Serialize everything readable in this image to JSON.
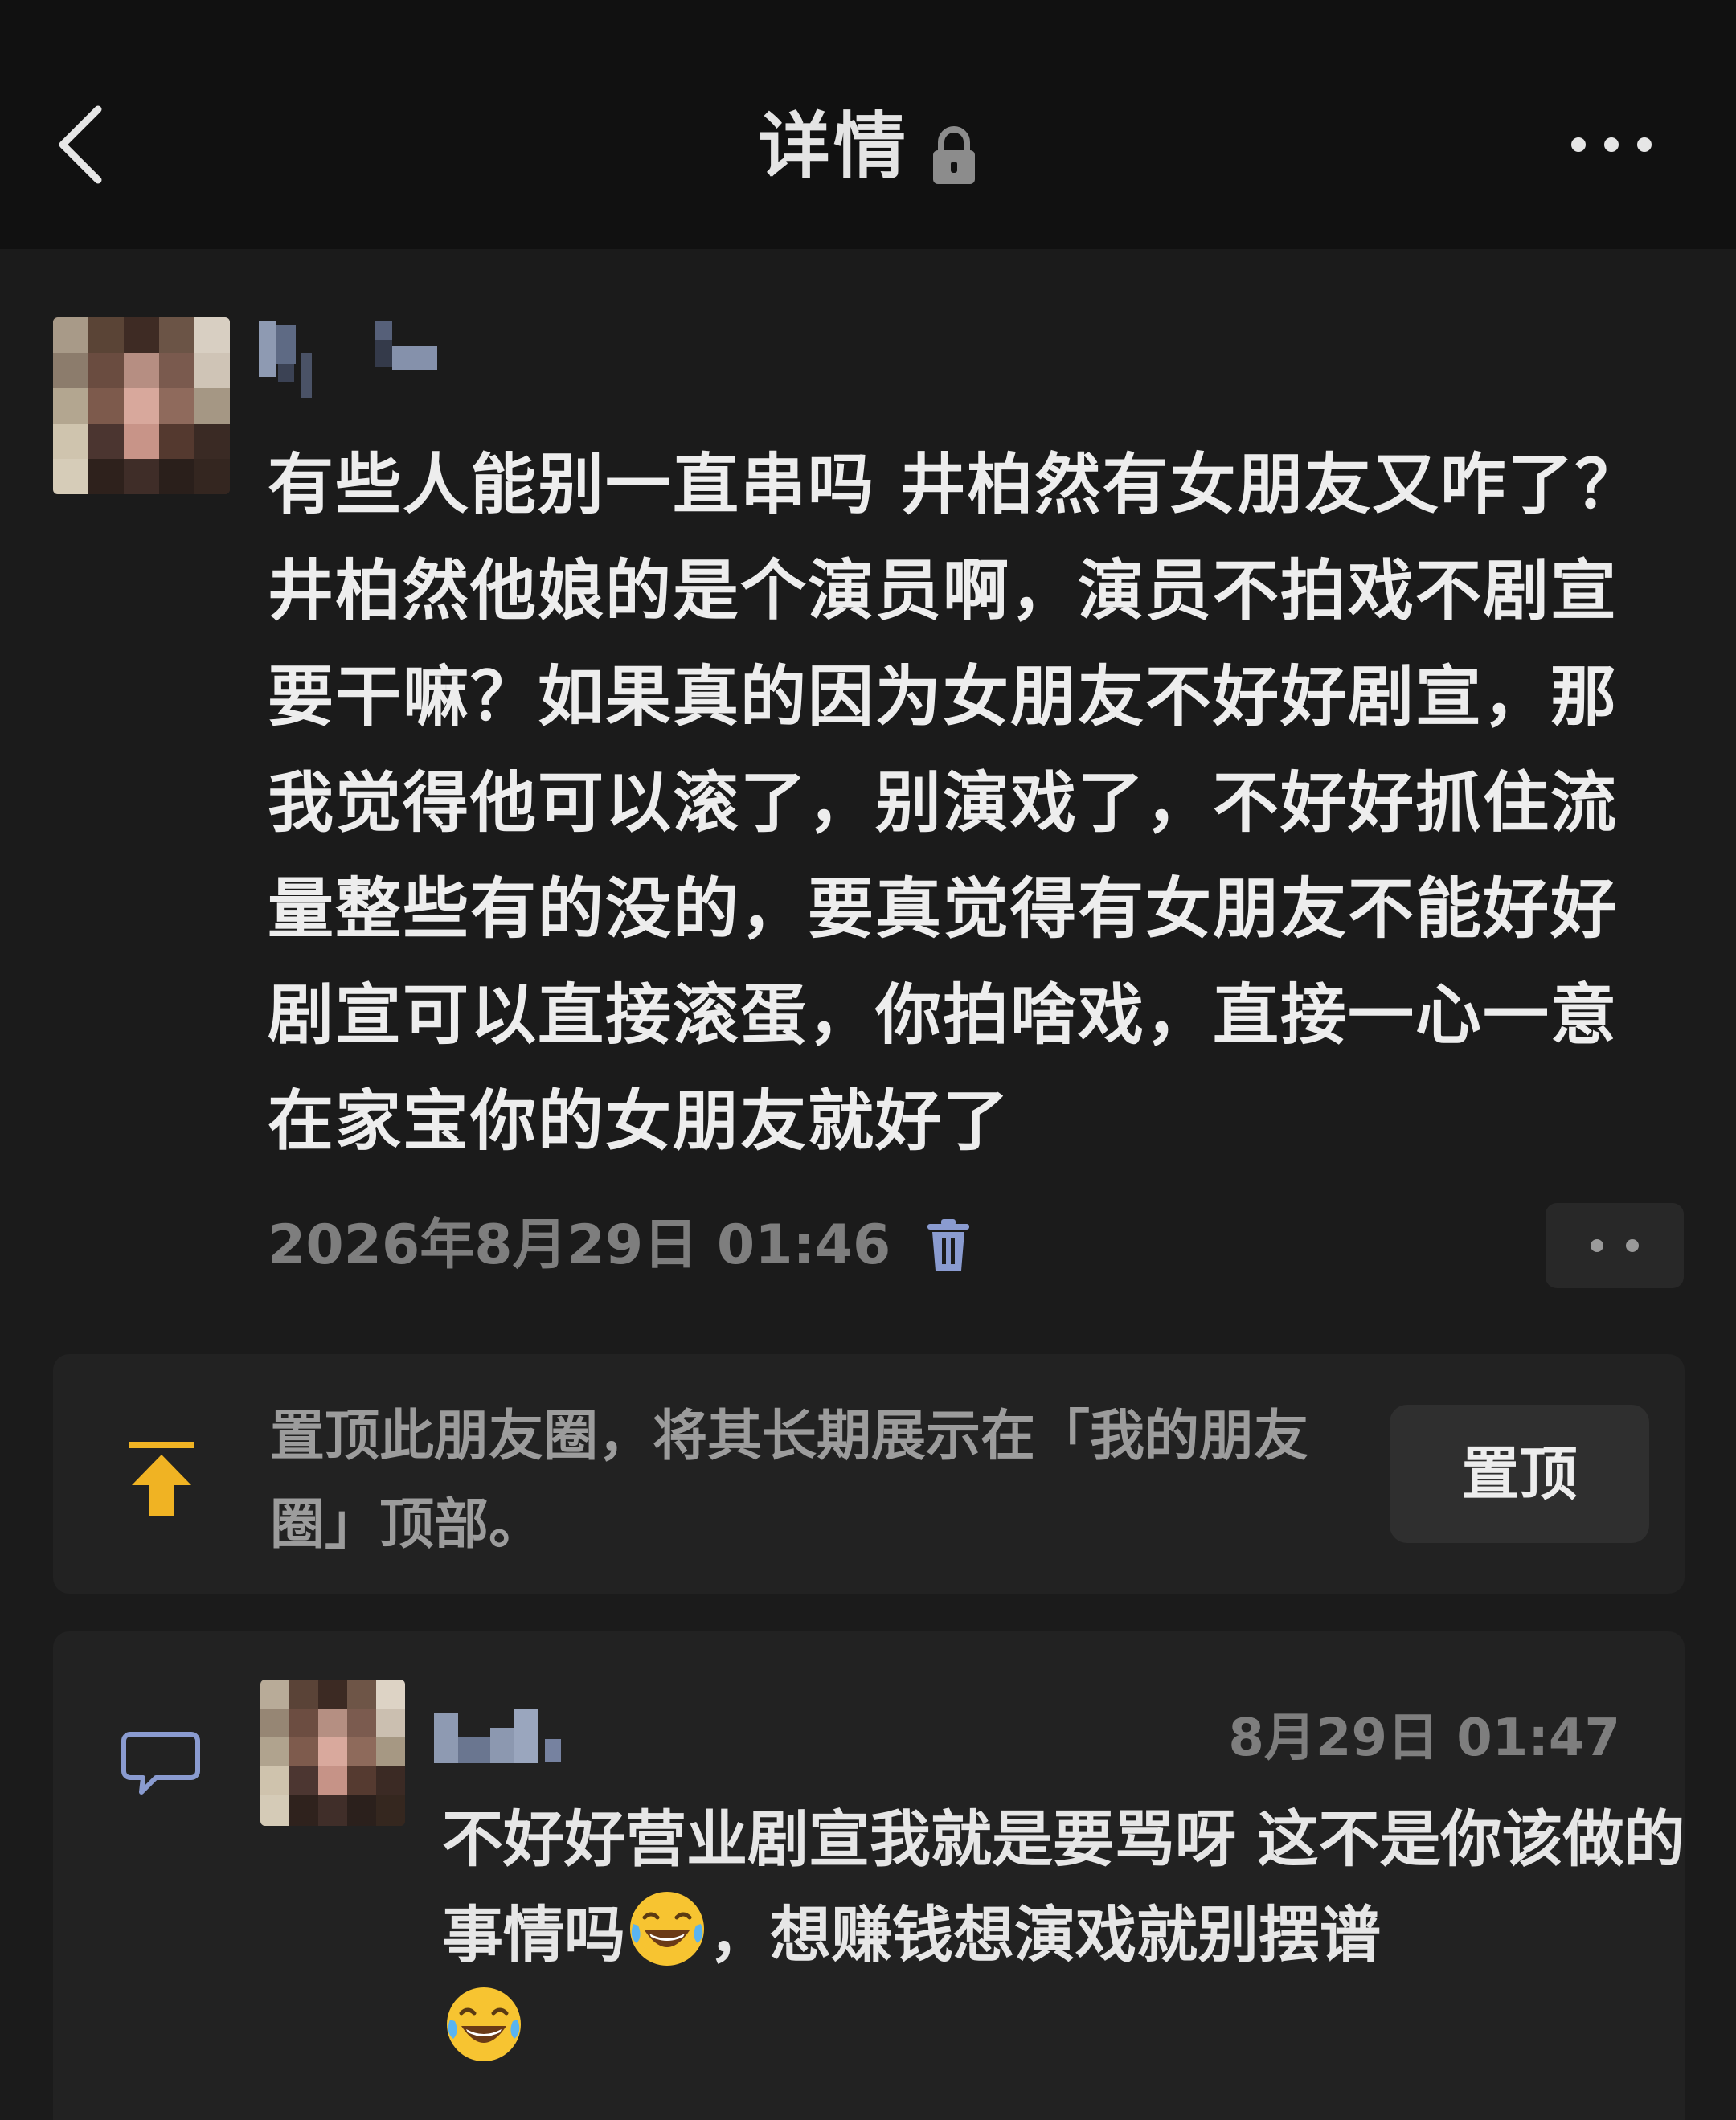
{
  "nav": {
    "title": "详情",
    "back_icon": "chevron-left-icon",
    "lock_icon": "lock-icon",
    "more_icon": "more-icon"
  },
  "post": {
    "text": "有些人能别一直串吗 井柏然有女朋友又咋了？井柏然他娘的是个演员啊，演员不拍戏不剧宣要干嘛？如果真的因为女朋友不好好剧宣，那我觉得他可以滚了，别演戏了，不好好抓住流量整些有的没的，要真觉得有女朋友不能好好剧宣可以直接滚蛋，你拍啥戏，直接一心一意在家宝你的女朋友就好了",
    "timestamp": "2026年8月29日 01:46",
    "delete_icon": "trash-icon"
  },
  "pin": {
    "description": "置顶此朋友圈，将其长期展示在「我的朋友圈」顶部。",
    "button_label": "置顶",
    "icon": "pin-top-icon",
    "accent": "#f0b323"
  },
  "comment": {
    "time": "8月29日 01:47",
    "text_part1": "不好好营业剧宣我就是要骂呀 这不是你该做的事情吗",
    "text_part2": "，想赚钱想演戏就别摆谱",
    "emoji": "tears-of-joy-emoji",
    "icon": "comment-icon"
  }
}
